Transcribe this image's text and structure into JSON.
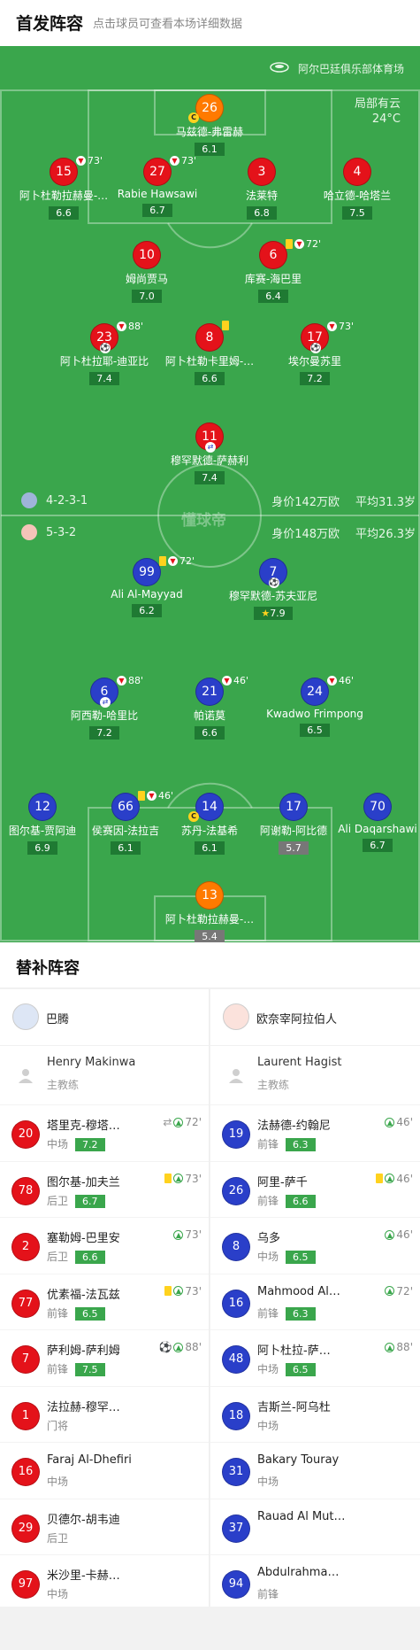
{
  "header": {
    "title": "首发阵容",
    "subtitle": "点击球员可查看本场详细数据"
  },
  "venue": {
    "name": "阿尔巴廷俱乐部体育场",
    "weather": "局部有云",
    "temp": "24°C"
  },
  "watermark": "懂球帝",
  "home_team": {
    "formation": "4-2-3-1",
    "value": "身价142万欧",
    "age": "平均31.3岁"
  },
  "away_team": {
    "formation": "5-3-2",
    "value": "身价148万欧",
    "age": "平均26.3岁"
  },
  "home_players": [
    {
      "num": "26",
      "name": "马兹德-弗雷赫",
      "rating": "6.1",
      "color": "orange",
      "captain": true
    },
    {
      "num": "15",
      "name": "阿卜杜勒拉赫曼-…",
      "rating": "6.6",
      "minute": "73'",
      "sub": true
    },
    {
      "num": "27",
      "name": "Rabie Hawsawi",
      "rating": "6.7",
      "minute": "73'",
      "sub": true
    },
    {
      "num": "3",
      "name": "法莱特",
      "rating": "6.8"
    },
    {
      "num": "4",
      "name": "哈立德-哈塔兰",
      "rating": "7.5"
    },
    {
      "num": "10",
      "name": "姆尚贾马",
      "rating": "7.0"
    },
    {
      "num": "6",
      "name": "库赛-海巴里",
      "rating": "6.4",
      "minute": "72'",
      "sub": true,
      "yellow": true
    },
    {
      "num": "23",
      "name": "阿卜杜拉耶-迪亚比",
      "rating": "7.4",
      "minute": "88'",
      "sub": true,
      "ball": true
    },
    {
      "num": "8",
      "name": "阿卜杜勒卡里姆-…",
      "rating": "6.6",
      "yellow": true
    },
    {
      "num": "17",
      "name": "埃尔曼苏里",
      "rating": "7.2",
      "minute": "73'",
      "sub": true,
      "ball": true
    },
    {
      "num": "11",
      "name": "穆罕默德-萨赫利",
      "rating": "7.4",
      "swap": true
    }
  ],
  "away_players": [
    {
      "num": "99",
      "name": "Ali Al-Mayyad",
      "rating": "6.2",
      "minute": "72'",
      "sub": true,
      "yellow": true
    },
    {
      "num": "7",
      "name": "穆罕默德-苏夫亚尼",
      "rating": "7.9",
      "star": true,
      "ball": true
    },
    {
      "num": "6",
      "name": "阿西勒-哈里比",
      "rating": "7.2",
      "minute": "88'",
      "sub": true,
      "swap": true
    },
    {
      "num": "21",
      "name": "帕诺莫",
      "rating": "6.6",
      "minute": "46'",
      "sub": true
    },
    {
      "num": "24",
      "name": "Kwadwo Frimpong",
      "rating": "6.5",
      "minute": "46'",
      "sub": true
    },
    {
      "num": "12",
      "name": "图尔基-贾阿迪",
      "rating": "6.9"
    },
    {
      "num": "66",
      "name": "侯赛因-法拉吉",
      "rating": "6.1",
      "minute": "46'",
      "sub": true,
      "yellow": true
    },
    {
      "num": "14",
      "name": "苏丹-法基希",
      "rating": "6.1",
      "captain": true
    },
    {
      "num": "17",
      "name": "阿谢勒-阿比德",
      "rating": "5.7",
      "grey": true
    },
    {
      "num": "70",
      "name": "Ali Daqarshawi",
      "rating": "6.7"
    },
    {
      "num": "13",
      "name": "阿卜杜勒拉赫曼-…",
      "rating": "5.4",
      "color": "orange",
      "grey": true
    }
  ],
  "subs": {
    "title": "替补阵容",
    "left": {
      "team": "巴腾",
      "coach": {
        "name": "Henry Makinwa",
        "role": "主教练"
      },
      "players": [
        {
          "num": "20",
          "name": "塔里克-穆塔…",
          "pos": "中场",
          "rating": "7.2",
          "ev": "72'",
          "assist": true
        },
        {
          "num": "78",
          "name": "图尔基-加夫兰",
          "pos": "后卫",
          "rating": "6.7",
          "ev": "73'",
          "yellow": true
        },
        {
          "num": "2",
          "name": "塞勒姆-巴里安",
          "pos": "后卫",
          "rating": "6.6",
          "ev": "73'"
        },
        {
          "num": "77",
          "name": "优素福-法瓦兹",
          "pos": "前锋",
          "rating": "6.5",
          "ev": "73'",
          "yellow": true
        },
        {
          "num": "7",
          "name": "萨利姆-萨利姆",
          "pos": "前锋",
          "rating": "7.5",
          "ev": "88'",
          "goal": true
        },
        {
          "num": "1",
          "name": "法拉赫-穆罕…",
          "pos": "门将"
        },
        {
          "num": "16",
          "name": "Faraj Al-Dhefiri",
          "pos": "中场"
        },
        {
          "num": "29",
          "name": "贝德尔-胡韦迪",
          "pos": "后卫"
        },
        {
          "num": "97",
          "name": "米沙里-卡赫…",
          "pos": "中场"
        }
      ]
    },
    "right": {
      "team": "欧奈宰阿拉伯人",
      "coach": {
        "name": "Laurent Hagist",
        "role": "主教练"
      },
      "players": [
        {
          "num": "19",
          "name": "法赫德-约翰尼",
          "pos": "前锋",
          "rating": "6.3",
          "ev": "46'"
        },
        {
          "num": "26",
          "name": "阿里-萨千",
          "pos": "前锋",
          "rating": "6.6",
          "ev": "46'",
          "yellow": true
        },
        {
          "num": "8",
          "name": "乌多",
          "pos": "中场",
          "rating": "6.5",
          "ev": "46'"
        },
        {
          "num": "16",
          "name": "Mahmood Alb…",
          "pos": "前锋",
          "rating": "6.3",
          "ev": "72'"
        },
        {
          "num": "48",
          "name": "阿卜杜拉-萨…",
          "pos": "中场",
          "rating": "6.5",
          "ev": "88'"
        },
        {
          "num": "18",
          "name": "吉斯兰-阿乌杜",
          "pos": "中场"
        },
        {
          "num": "31",
          "name": "Bakary Touray",
          "pos": "中场"
        },
        {
          "num": "37",
          "name": "Rauad Al Mut…",
          "pos": ""
        },
        {
          "num": "94",
          "name": "Abdulrahman …",
          "pos": "前锋"
        }
      ]
    }
  }
}
